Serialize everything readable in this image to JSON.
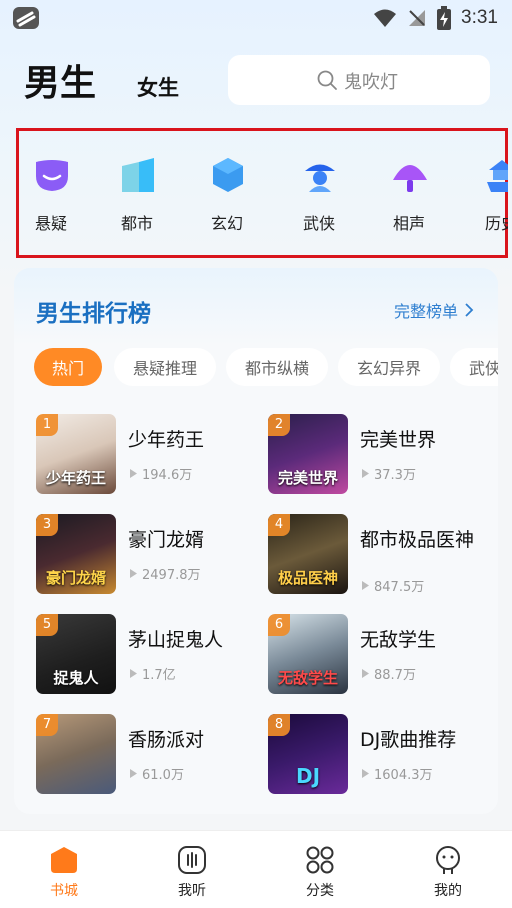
{
  "status_bar": {
    "time": "3:31"
  },
  "header": {
    "tab_male": "男生",
    "tab_female": "女生",
    "search_placeholder": "鬼吹灯"
  },
  "categories": [
    {
      "label": "悬疑",
      "icon": "mask-icon",
      "color": "#8b5cf6"
    },
    {
      "label": "都市",
      "icon": "building-icon",
      "color": "#38bdf8"
    },
    {
      "label": "玄幻",
      "icon": "hexagon-gem-icon",
      "color": "#3b82f6"
    },
    {
      "label": "武侠",
      "icon": "swordsman-hat-icon",
      "color": "#2563eb"
    },
    {
      "label": "相声",
      "icon": "folding-fan-icon",
      "color": "#a855f7"
    },
    {
      "label": "历史",
      "icon": "pagoda-icon",
      "color": "#3b82f6"
    }
  ],
  "ranking": {
    "title": "男生排行榜",
    "more_label": "完整榜单",
    "chips": [
      "热门",
      "悬疑推理",
      "都市纵横",
      "玄幻异界",
      "武侠"
    ],
    "active_chip": "热门",
    "books": [
      {
        "rank": "1",
        "title": "少年药王",
        "plays": "194.6万",
        "cover_text": "少年药王"
      },
      {
        "rank": "2",
        "title": "完美世界",
        "plays": "37.3万",
        "cover_text": "完美世界"
      },
      {
        "rank": "3",
        "title": "豪门龙婿",
        "plays": "2497.8万",
        "cover_text": "豪门龙婿"
      },
      {
        "rank": "4",
        "title": "都市极品医神",
        "plays": "847.5万",
        "cover_text": "极品医神"
      },
      {
        "rank": "5",
        "title": "茅山捉鬼人",
        "plays": "1.7亿",
        "cover_text": "捉鬼人"
      },
      {
        "rank": "6",
        "title": "无敌学生",
        "plays": "88.7万",
        "cover_text": "无敌学生"
      },
      {
        "rank": "7",
        "title": "香肠派对",
        "plays": "61.0万",
        "cover_text": ""
      },
      {
        "rank": "8",
        "title": "DJ歌曲推荐",
        "plays": "1604.3万",
        "cover_text": "DJ"
      }
    ]
  },
  "bottom_nav": {
    "items": [
      {
        "label": "书城",
        "icon": "bookstore-icon"
      },
      {
        "label": "我听",
        "icon": "listen-icon"
      },
      {
        "label": "分类",
        "icon": "category-grid-icon"
      },
      {
        "label": "我的",
        "icon": "profile-icon"
      }
    ],
    "active": "书城"
  },
  "colors": {
    "accent_orange": "#ff8a25",
    "rank_title_blue": "#1a6fc1",
    "highlight_frame_red": "#d9141c"
  }
}
